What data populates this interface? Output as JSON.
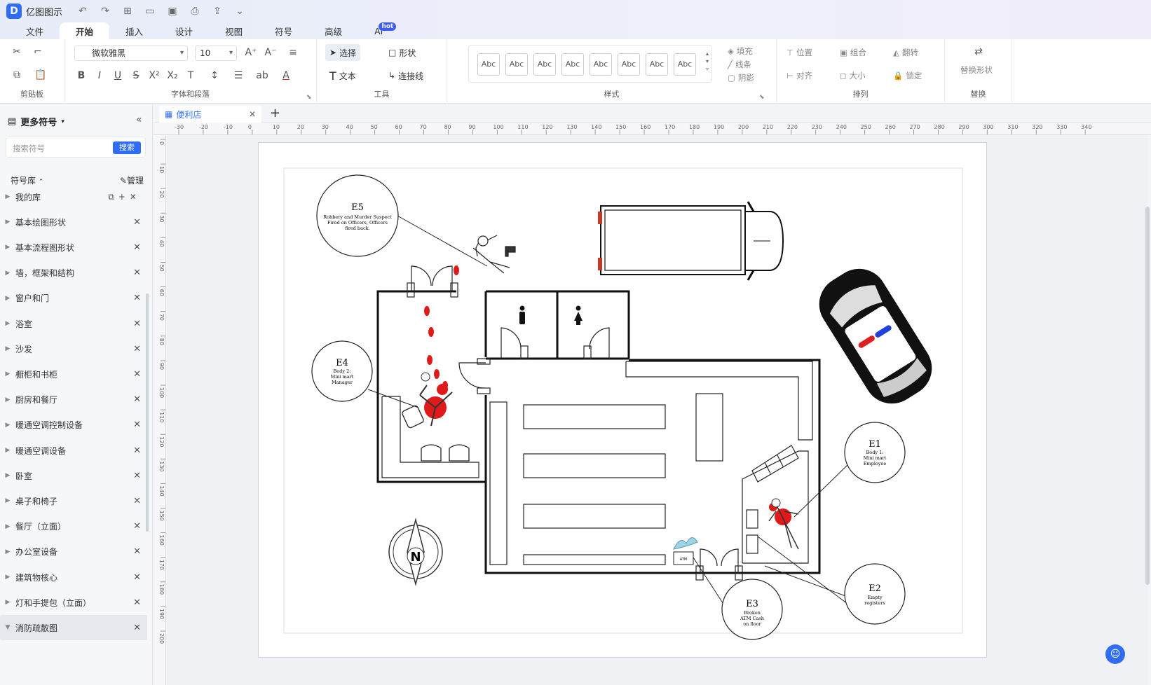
{
  "app": {
    "name": "亿图图示"
  },
  "menu": [
    "文件",
    "开始",
    "插入",
    "设计",
    "视图",
    "符号",
    "高级",
    "AI"
  ],
  "menu_badge": "hot",
  "ribbon": {
    "font_name": "微软雅黑",
    "font_size": "10",
    "select_label": "选择",
    "shape_label": "形状",
    "text_label": "文本",
    "connector_label": "连接线",
    "style_samples": [
      "Abc",
      "Abc",
      "Abc",
      "Abc",
      "Abc",
      "Abc",
      "Abc",
      "Abc"
    ],
    "fill_label": "填充",
    "line_label": "线条",
    "shadow_label": "阴影",
    "position_label": "位置",
    "group_label": "组合",
    "flip_label": "翻转",
    "align_label": "对齐",
    "size_label": "大小",
    "lock_label": "锁定",
    "replace_label": "替换形状",
    "groups": {
      "clipboard": "剪贴板",
      "font": "字体和段落",
      "tools": "工具",
      "style": "样式",
      "arrange": "排列",
      "replace": "替换"
    }
  },
  "sidebar": {
    "title": "更多符号",
    "search_placeholder": "搜索符号",
    "search_button": "搜索",
    "library_label": "符号库",
    "manage_label": "管理",
    "items": [
      "我的库",
      "基本绘图形状",
      "基本流程图形状",
      "墙，框架和结构",
      "窗户和门",
      "浴室",
      "沙发",
      "橱柜和书柜",
      "厨房和餐厅",
      "暖通空调控制设备",
      "暖通空调设备",
      "卧室",
      "桌子和椅子",
      "餐厅（立面）",
      "办公室设备",
      "建筑物核心",
      "灯和手提包（立面）",
      "消防疏散图"
    ]
  },
  "document": {
    "tab_title": "便利店"
  },
  "ruler": {
    "h": [
      "-30",
      "-20",
      "-10",
      "0",
      "10",
      "20",
      "30",
      "40",
      "50",
      "60",
      "70",
      "80",
      "90",
      "100",
      "110",
      "120",
      "130",
      "140",
      "150",
      "160",
      "170",
      "180",
      "190",
      "200",
      "210",
      "220",
      "230",
      "240",
      "250",
      "260",
      "270",
      "280",
      "290",
      "300",
      "310",
      "320",
      "330",
      "340"
    ],
    "v": [
      "0",
      "10",
      "20",
      "30",
      "40",
      "50",
      "60",
      "70",
      "80",
      "90",
      "100",
      "110",
      "120",
      "130",
      "140",
      "150",
      "160",
      "170",
      "180",
      "190",
      "200"
    ]
  },
  "evidence": [
    {
      "id": "E5",
      "text": [
        "Robbery and Murder Suspect",
        "Fired on Officers, Officers",
        "fired back."
      ]
    },
    {
      "id": "E4",
      "text": [
        "Body 2:",
        "Mini mart",
        "Manager"
      ]
    },
    {
      "id": "E1",
      "text": [
        "Body 1:",
        "Mini mart",
        "Employee"
      ]
    },
    {
      "id": "E2",
      "text": [
        "Empty",
        "registers"
      ]
    },
    {
      "id": "E3",
      "text": [
        "Broken",
        "ATM Cash",
        "on floor"
      ]
    }
  ],
  "compass_label": "N",
  "atm_label": "ATM",
  "colors": {
    "accent": "#2f6df6",
    "blood": "#e01a1a"
  }
}
